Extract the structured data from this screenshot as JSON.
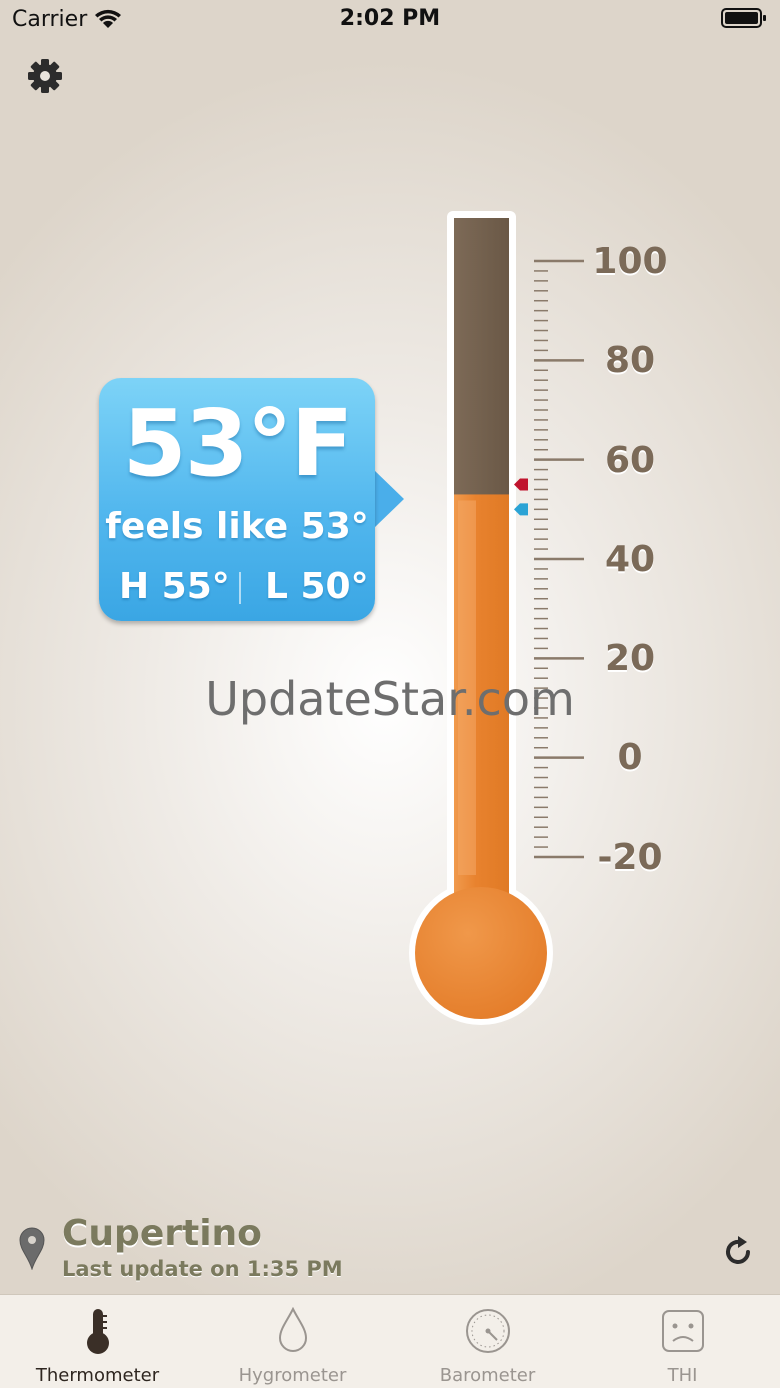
{
  "status_bar": {
    "carrier": "Carrier",
    "time": "2:02 PM"
  },
  "weather": {
    "temperature": "53°F",
    "feels_like": "feels like 53°",
    "high": "H 55°",
    "low": "L 50°"
  },
  "thermometer": {
    "unit": "F",
    "current": 53,
    "scale_labels": [
      "100",
      "80",
      "60",
      "40",
      "20",
      "0",
      "-20"
    ],
    "scale_min": -20,
    "scale_max": 100,
    "high_marker": 55,
    "low_marker": 50,
    "colors": {
      "mercury": "#e8822e",
      "empty": "#6e5c4b",
      "high_marker": "#c0142e",
      "low_marker": "#2ba3d5"
    }
  },
  "watermark": "UpdateStar.com",
  "location": {
    "city": "Cupertino",
    "last_update": "Last update on 1:35 PM"
  },
  "tabs": [
    {
      "label": "Thermometer",
      "icon": "thermometer-icon",
      "active": true
    },
    {
      "label": "Hygrometer",
      "icon": "droplet-icon",
      "active": false
    },
    {
      "label": "Barometer",
      "icon": "gauge-icon",
      "active": false
    },
    {
      "label": "THI",
      "icon": "sad-face-icon",
      "active": false
    }
  ]
}
